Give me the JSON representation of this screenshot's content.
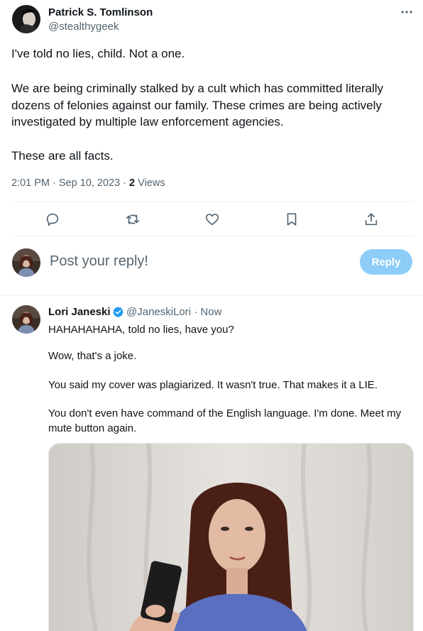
{
  "main_tweet": {
    "author_name": "Patrick S. Tomlinson",
    "author_handle": "@stealthygeek",
    "paragraphs": [
      "I've told no lies, child. Not a one.",
      "We are being criminally stalked by a cult which has committed literally dozens of felonies against our family. These crimes are being actively investigated by multiple law enforcement agencies.",
      "These are all facts."
    ],
    "timestamp": "2:01 PM · Sep 10, 2023 · ",
    "views_count": "2",
    "views_label": " Views"
  },
  "actions": {
    "reply_icon": "comment-icon",
    "retweet_icon": "retweet-icon",
    "like_icon": "heart-icon",
    "bookmark_icon": "bookmark-icon",
    "share_icon": "share-icon"
  },
  "composer": {
    "placeholder": "Post your reply!",
    "reply_button": "Reply"
  },
  "reply": {
    "author_name": "Lori Janeski",
    "author_handle": "@JaneskiLori · Now",
    "paragraphs": [
      "HAHAHAHAHA, told no lies, have you?",
      "Wow, that's a joke.",
      "You said my cover was plagiarized.  It wasn't true.  That makes it a LIE.",
      "You don't even have command of the English language.  I'm done.  Meet my mute button again."
    ]
  },
  "colors": {
    "accent": "#1d9bf0",
    "reply_button_disabled": "#8ecdf8",
    "secondary_text": "#536471"
  }
}
